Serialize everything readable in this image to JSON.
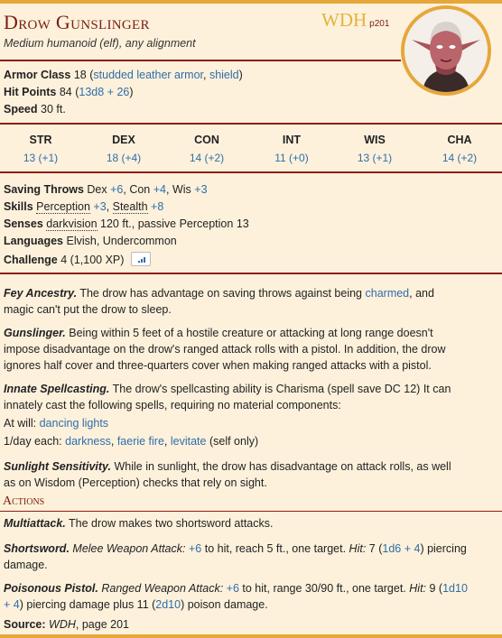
{
  "header": {
    "name": "Drow Gunslinger",
    "source_abbr": "WDH",
    "source_page": "p201",
    "meta": "Medium humanoid (elf), any alignment"
  },
  "stats": {
    "armor_class_label": "Armor Class",
    "armor_class_value": "18",
    "armor_paren_open": "(",
    "armor_link1": "studded leather armor",
    "armor_sep": ", ",
    "armor_link2": "shield",
    "armor_paren_close": ")",
    "hp_label": "Hit Points",
    "hp_value": "84",
    "hp_paren_open": "(",
    "hp_formula": "13d8 + 26",
    "hp_paren_close": ")",
    "speed_label": "Speed",
    "speed_value": "30 ft."
  },
  "abilities": [
    {
      "name": "STR",
      "value": "13 (+1)"
    },
    {
      "name": "DEX",
      "value": "18 (+4)"
    },
    {
      "name": "CON",
      "value": "14 (+2)"
    },
    {
      "name": "INT",
      "value": "11 (+0)"
    },
    {
      "name": "WIS",
      "value": "13 (+1)"
    },
    {
      "name": "CHA",
      "value": "14 (+2)"
    }
  ],
  "details": {
    "saves_label": "Saving Throws",
    "saves_dex": "Dex",
    "saves_dex_val": "+6",
    "saves_con": ", Con",
    "saves_con_val": "+4",
    "saves_wis": ", Wis",
    "saves_wis_val": "+3",
    "skills_label": "Skills",
    "skill1": "Perception",
    "skill1_val": "+3",
    "skill_sep": ", ",
    "skill2": "Stealth",
    "skill2_val": "+8",
    "senses_label": "Senses",
    "senses_dv": "darkvision",
    "senses_rest": "120 ft., passive Perception 13",
    "languages_label": "Languages",
    "languages_value": "Elvish, Undercommon",
    "challenge_label": "Challenge",
    "challenge_value": "4 (1,100 XP)"
  },
  "traits": {
    "fey_title": "Fey Ancestry.",
    "fey_text1": "The drow has advantage on saving throws against being",
    "fey_link": "charmed",
    "fey_text2": ", and",
    "fey_text3": "magic can't put the drow to sleep.",
    "gun_title": "Gunslinger.",
    "gun_text1": "Being within 5 feet of a hostile creature or attacking at long range doesn't",
    "gun_text2": "impose disadvantage on the drow's ranged attack rolls with a pistol. In addition, the drow",
    "gun_text3": "ignores half cover and three-quarters cover when making ranged attacks with a pistol.",
    "spell_title": "Innate Spellcasting.",
    "spell_text1": "The drow's spellcasting ability is Charisma (spell save DC 12) It can",
    "spell_text2": "innately cast the following spells, requiring no material components:",
    "atwill_label": "At will:",
    "atwill_spell": "dancing lights",
    "perday_label": "1/day each:",
    "perday_spell1": "darkness",
    "perday_spell2": "faerie fire",
    "perday_spell3": "levitate",
    "perday_sep": ", ",
    "perday_note": "(self only)",
    "sun_title": "Sunlight Sensitivity.",
    "sun_text1": "While in sunlight, the drow has disadvantage on attack rolls, as well",
    "sun_text2": "as on Wisdom (Perception) checks that rely on sight."
  },
  "actions": {
    "heading": "Actions",
    "multi_title": "Multiattack.",
    "multi_text": "The drow makes two shortsword attacks.",
    "short_title": "Shortsword.",
    "short_type": "Melee Weapon Attack:",
    "short_hit_bonus": "+6",
    "short_text1": "to hit, reach 5 ft., one target.",
    "short_hit_label": "Hit:",
    "short_dmg_avg": "7 (",
    "short_dmg_roll": "1d6 + 4",
    "short_dmg_type": ") piercing",
    "short_text2": "damage.",
    "pistol_title": "Poisonous Pistol.",
    "pistol_type": "Ranged Weapon Attack:",
    "pistol_hit_bonus": "+6",
    "pistol_text1": "to hit, range 30/90 ft., one target.",
    "pistol_hit_label": "Hit:",
    "pistol_dmg_avg": "9 (",
    "pistol_dmg_roll_a": "1d10",
    "pistol_dmg_roll_b": "+ 4",
    "pistol_text2": ") piercing damage plus 11 (",
    "pistol_poison_roll": "2d10",
    "pistol_text3": ") poison damage."
  },
  "footer": {
    "source_label": "Source:",
    "source_book": "WDH",
    "source_page": ", page 201"
  },
  "colors": {
    "title": "#7b1c10",
    "rule": "#8b1e12",
    "link": "#2f6ea8",
    "accent": "#e6a73a",
    "background": "#fdf1dc"
  }
}
